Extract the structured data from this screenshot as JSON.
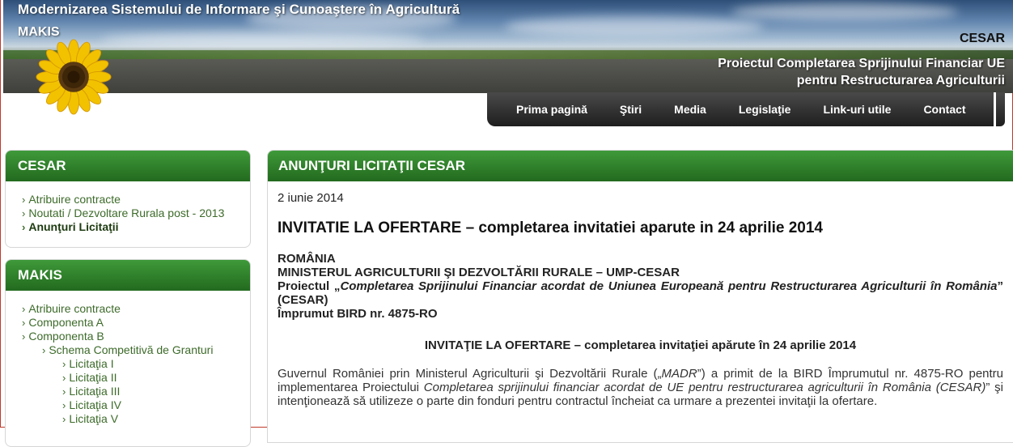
{
  "header": {
    "site_title": "Modernizarea Sistemului de Informare şi Cunoaştere în Agricultură",
    "makis_logo": "MAKIS",
    "cesar_logo": "CESAR",
    "project_line1": "Proiectul Completarea Sprijinului Financiar  UE",
    "project_line2": "pentru Restructurarea Agriculturii"
  },
  "nav": {
    "items": [
      "Prima pagină",
      "Ştiri",
      "Media",
      "Legislaţie",
      "Link-uri utile",
      "Contact"
    ]
  },
  "sidebar": {
    "cesar": {
      "title": "CESAR",
      "items": [
        "Atribuire contracte",
        "Noutati / Dezvoltare Rurala post - 2013",
        "Anunţuri Licitaţii"
      ]
    },
    "makis": {
      "title": "MAKIS",
      "items": [
        "Atribuire contracte",
        "Componenta A",
        "Componenta B",
        "Schema Competitivă de Granturi",
        "Licitaţia I",
        "Licitaţia II",
        "Licitaţia III",
        "Licitaţia IV",
        "Licitaţia V"
      ]
    }
  },
  "main": {
    "title": "ANUNŢURI LICITAŢII CESAR",
    "date": "2 iunie 2014",
    "headline": "INVITATIE LA OFERTARE – completarea invitatiei aparute in 24 aprilie 2014",
    "addr_line1": "ROMÂNIA",
    "addr_line2": "MINISTERUL AGRICULTURII ŞI DEZVOLTĂRII RURALE – UMP-CESAR",
    "addr_proj_prefix": "Proiectul „",
    "addr_proj_italic": "Completarea Sprijinului Financiar acordat de Uniunea Europeană pentru Restructurarea Agriculturii în România",
    "addr_proj_suffix": "” (CESAR)",
    "addr_line4": "Împrumut BIRD nr. 4875-RO",
    "centered_title": "INVITAŢIE LA OFERTARE – completarea invitaţiei apărute în 24 aprilie 2014",
    "para_part1": "Guvernul României prin Ministerul Agriculturii şi Dezvoltării Rurale („",
    "para_madr": "MADR",
    "para_part2": "”) a primit de la BIRD Împrumutul nr. 4875-RO pentru implementarea Proiectului ",
    "para_italic": "Completarea sprijinului financiar acordat de UE pentru restructurarea agriculturii în România (CESAR)",
    "para_part3": "” şi intenţionează să utilizeze o parte din fonduri pentru contractul încheiat ca urmare a prezentei invitaţii la ofertare."
  },
  "colors": {
    "green_header": "#2f7f2a",
    "nav_bg": "#2a2a2a",
    "link_green": "#3d6b2a"
  }
}
